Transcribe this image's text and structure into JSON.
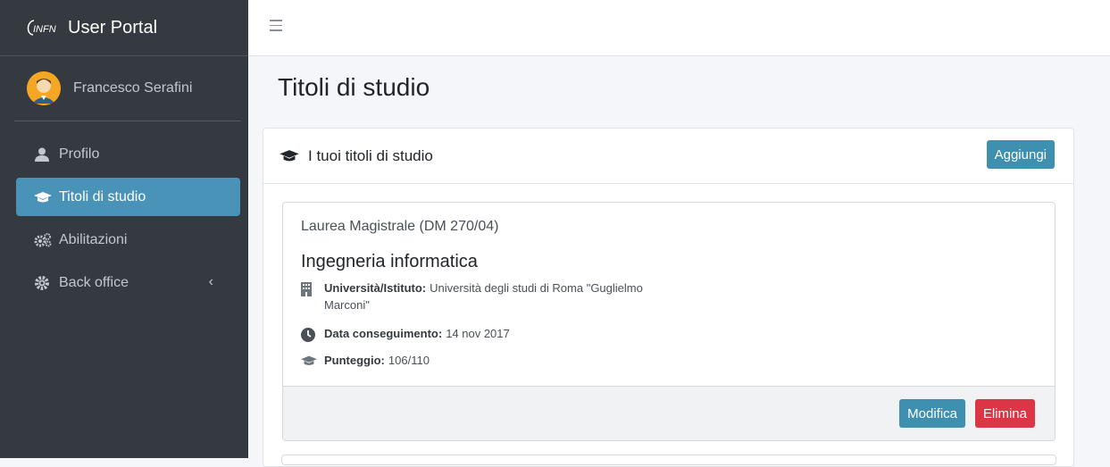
{
  "brand": {
    "logo_text": "INFN",
    "title": "User Portal"
  },
  "user": {
    "name": "Francesco Serafini"
  },
  "sidebar": {
    "items": [
      {
        "label": "Profilo",
        "icon": "user-icon"
      },
      {
        "label": "Titoli di studio",
        "icon": "graduation-cap-icon",
        "active": true
      },
      {
        "label": "Abilitazioni",
        "icon": "cogs-icon"
      },
      {
        "label": "Back office",
        "icon": "cog-icon",
        "caret": "‹"
      }
    ]
  },
  "page": {
    "title": "Titoli di studio"
  },
  "card": {
    "header": "I tuoi titoli di studio",
    "add_label": "Aggiungi"
  },
  "degree": {
    "type": "Laurea Magistrale (DM 270/04)",
    "title": "Ingegneria informatica",
    "university_label": "Università/Istituto:",
    "university_value": "Università degli studi di Roma \"Guglielmo",
    "university_value_2": "Marconi\"",
    "date_label": "Data conseguimento:",
    "date_value": "14 nov 2017",
    "score_label": "Punteggio:",
    "score_value": "106/110",
    "edit_label": "Modifica",
    "delete_label": "Elimina"
  },
  "colors": {
    "sidebar_bg": "#343a40",
    "active": "#4a93b8",
    "info": "#3e8fb0",
    "danger": "#dc3545"
  }
}
